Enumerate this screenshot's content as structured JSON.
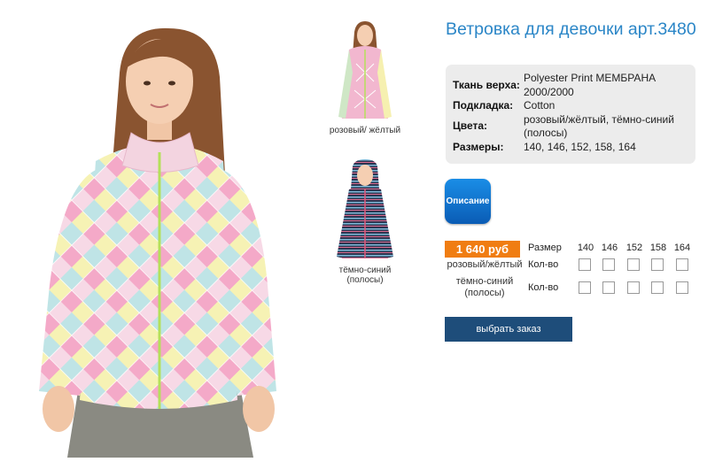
{
  "product": {
    "title": "Ветровка для девочки арт.3480"
  },
  "specs": [
    {
      "key": "Ткань верха:",
      "value": "Polyester Print МЕМБРАНА 2000/2000"
    },
    {
      "key": "Подкладка:",
      "value": "Cotton"
    },
    {
      "key": "Цвета:",
      "value": "розовый/жёлтый, тёмно-синий (полосы)"
    },
    {
      "key": "Размеры:",
      "value": "140, 146, 152, 158, 164"
    }
  ],
  "thumbnails": [
    {
      "label": "розовый/ жёлтый"
    },
    {
      "label": "тёмно-синий (полосы)"
    }
  ],
  "description_button": "Описание",
  "price": "1 640 руб",
  "size_table": {
    "size_label": "Размер",
    "sizes": [
      "140",
      "146",
      "152",
      "158",
      "164"
    ],
    "rows": [
      {
        "color": "розовый/жёлтый",
        "qty_label": "Кол-во"
      },
      {
        "color": "тёмно-синий (полосы)",
        "qty_label": "Кол-во"
      }
    ]
  },
  "order_button": "выбрать заказ",
  "colors": {
    "title": "#2b86c7",
    "price_badge": "#f07d12",
    "order_button": "#1e4d7a",
    "description_button": "#0a6fd0"
  },
  "icons": {
    "main_image": "girl-in-patterned-jacket-photo",
    "thumb_pink": "pink-yellow-jacket-photo",
    "thumb_navy": "navy-striped-jacket-photo"
  }
}
